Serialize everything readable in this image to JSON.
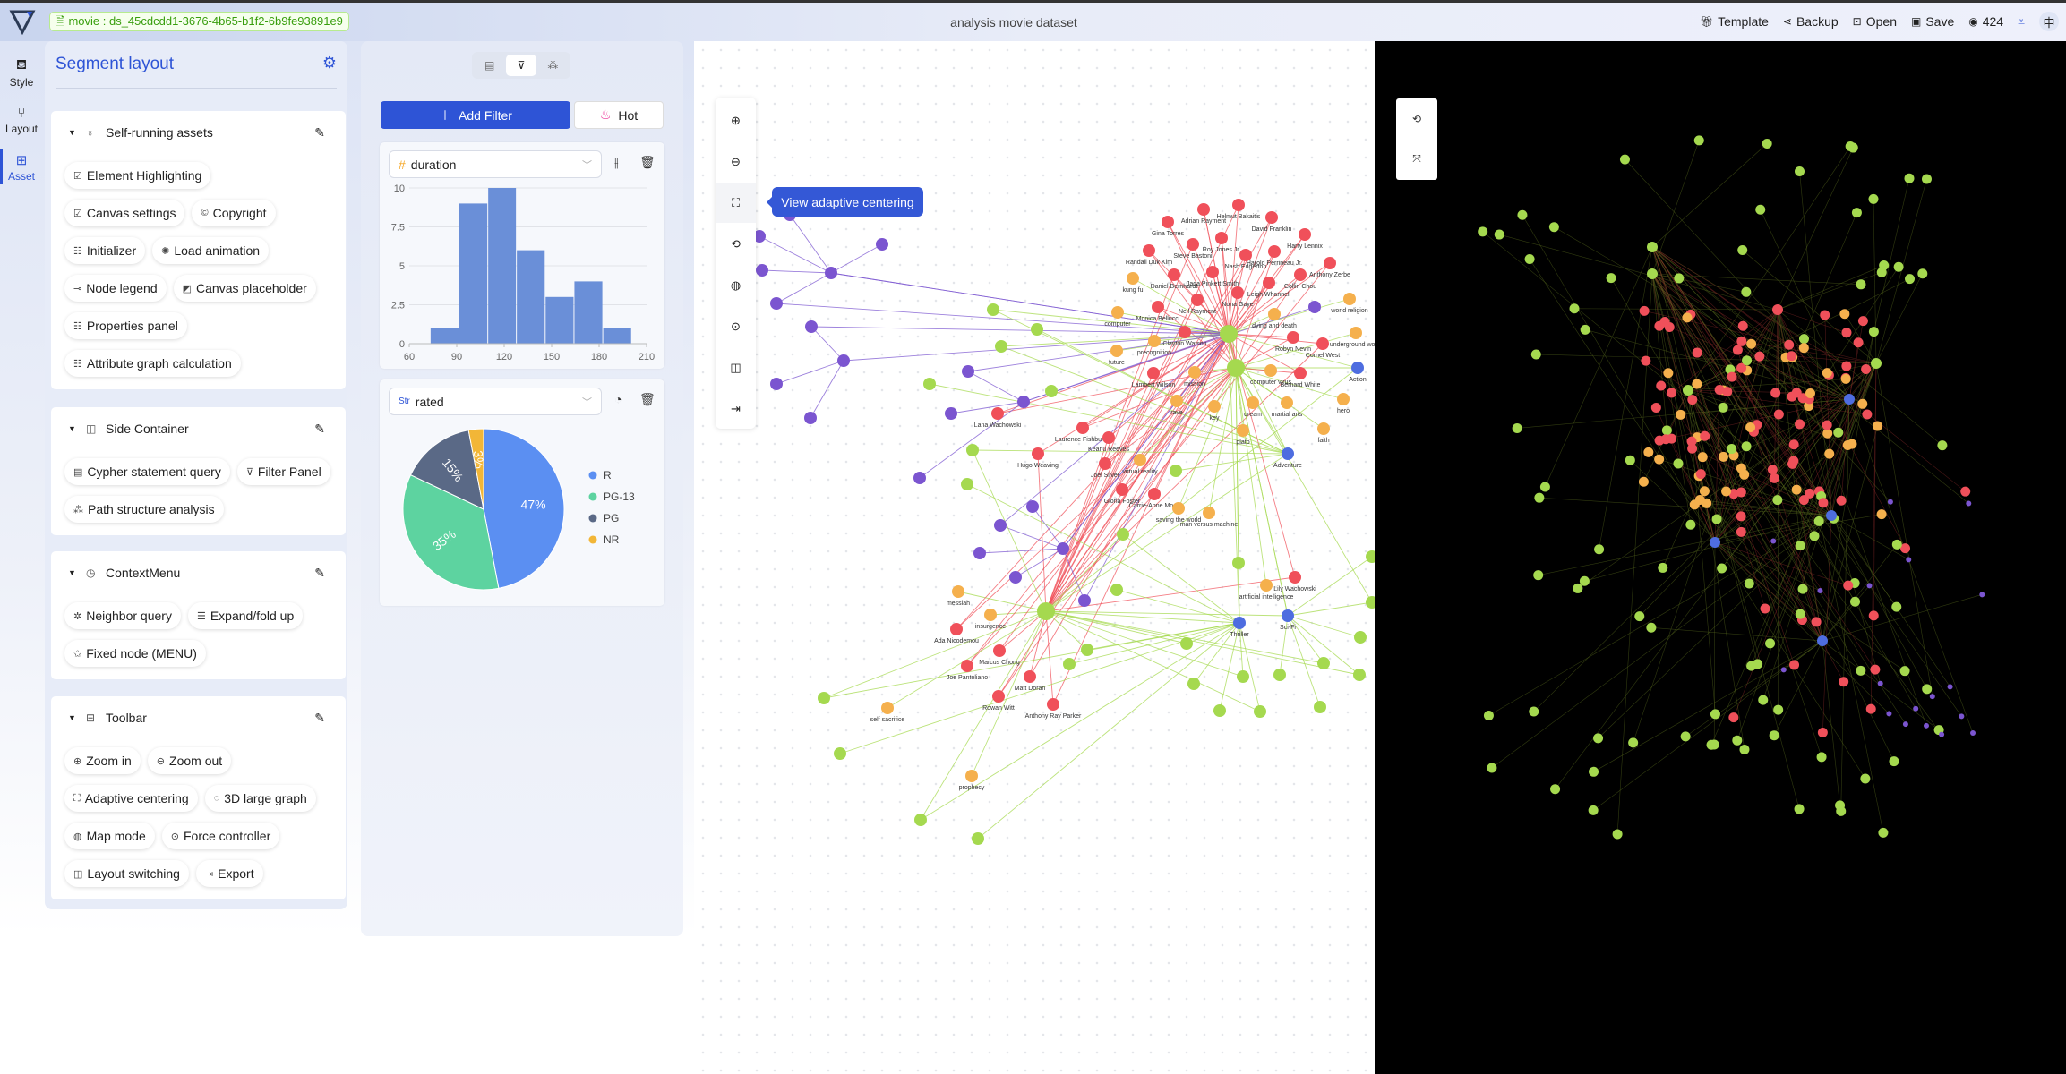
{
  "topbar": {
    "dataset": "movie : ds_45cdcdd1-3676-4b65-b1f2-6b9fe93891e9",
    "title": "analysis movie dataset",
    "actions": [
      {
        "icon": "gift-icon",
        "label": "Template"
      },
      {
        "icon": "share-icon",
        "label": "Backup"
      },
      {
        "icon": "terminal-icon",
        "label": "Open"
      },
      {
        "icon": "save-icon",
        "label": "Save"
      },
      {
        "icon": "github-icon",
        "label": "424"
      }
    ],
    "lang": "中"
  },
  "rail": [
    {
      "label": "Style",
      "icon": "paint-bucket-icon"
    },
    {
      "label": "Layout",
      "icon": "branch-icon"
    },
    {
      "label": "Asset",
      "icon": "grid-icon",
      "active": true
    }
  ],
  "segment": {
    "title": "Segment layout",
    "cards": [
      {
        "title": "Self-running assets",
        "items": [
          "Element Highlighting",
          "Canvas settings",
          "Copyright",
          "Initializer",
          "Load animation",
          "Node legend",
          "Canvas placeholder",
          "Properties panel",
          "Attribute graph calculation"
        ]
      },
      {
        "title": "Side Container",
        "items": [
          "Cypher statement query",
          "Filter Panel",
          "Path structure analysis"
        ]
      },
      {
        "title": "ContextMenu",
        "items": [
          "Neighbor query",
          "Expand/fold up",
          "Fixed node (MENU)"
        ]
      },
      {
        "title": "Toolbar",
        "items": [
          "Zoom in",
          "Zoom out",
          "Adaptive centering",
          "3D large graph",
          "Map mode",
          "Force controller",
          "Layout switching",
          "Export"
        ]
      }
    ]
  },
  "filter": {
    "add_label": "Add Filter",
    "hot_label": "Hot",
    "field1": "duration",
    "field1_type": "#",
    "field2": "rated",
    "field2_type": "Str"
  },
  "chart_data": [
    {
      "type": "bar",
      "subtype": "histogram",
      "field": "duration",
      "bins": [
        [
          73.5,
          91.7
        ],
        [
          91.7,
          109.9
        ],
        [
          109.9,
          128
        ],
        [
          128,
          146.2
        ],
        [
          146.2,
          164.4
        ],
        [
          164.4,
          182.6
        ],
        [
          182.6,
          200.8
        ]
      ],
      "values": [
        1,
        9,
        10,
        6,
        3,
        4,
        1
      ],
      "xticks": [
        "60",
        "90",
        "120",
        "150",
        "180",
        "210"
      ],
      "yticks": [
        "0",
        "2.5",
        "5",
        "7.5",
        "10"
      ],
      "xlim": [
        60,
        210
      ],
      "ylim": [
        0,
        10
      ],
      "grid": true,
      "color": "#6a8fd8"
    },
    {
      "type": "pie",
      "field": "rated",
      "categories": [
        "R",
        "PG-13",
        "PG",
        "NR"
      ],
      "values": [
        47,
        35,
        15,
        3
      ],
      "labels": [
        "47%",
        "35%",
        "15%",
        "3%"
      ],
      "colors": [
        "#5b8ff2",
        "#5dd3a0",
        "#5a6986",
        "#f2b637"
      ],
      "legend": "right"
    }
  ],
  "canvas": {
    "tooltip": "View adaptive centering",
    "tools": [
      "zoom-in-icon",
      "zoom-out-icon",
      "center-icon",
      "2d-icon",
      "globe-icon",
      "play-icon",
      "layout-icon",
      "export-icon"
    ]
  },
  "graph": {
    "colors": {
      "person": "#f0505a",
      "keyword": "#f5b04d",
      "movie": "#a5d94f",
      "user": "#7b55d0",
      "genre": "#4e6de0"
    },
    "labels": [
      "Helmut Bakaitis",
      "Adrian Rayment",
      "David Franklin",
      "Gina Torres",
      "Harry Lennix",
      "Roy Jones Jr.",
      "Steve Bastoni",
      "Randall Duk Kim",
      "Nash Edgerton",
      "Harold Perrineau Jr.",
      "Anthony Zerbe",
      "Jada Pinkett Smith",
      "Daniel Bernhardt",
      "Collin Chou",
      "Leigh Whannell",
      "Nona Gaye",
      "Neil Rayment",
      "Monica Bellucci",
      "kung fu",
      "world religion",
      "dying and death",
      "computer",
      "Clayton Watson",
      "Robyn Nevin",
      "Cornel West",
      "underground world",
      "precognition",
      "future",
      "Lambert Wilson",
      "mission",
      "computer virus",
      "Bernard White",
      "Action",
      "Lana Wachowski",
      "rave",
      "key",
      "dream",
      "martial arts",
      "hero",
      "faith",
      "plato",
      "Laurence Fishburne",
      "Keanu Reeves",
      "Adventure",
      "Hugo Weaving",
      "Joel Silver",
      "virtual reality",
      "Gloria Foster",
      "Carrie-Anne Moss",
      "saving the world",
      "man versus machine",
      "messiah",
      "Lily Wachowski",
      "artificial intelligence",
      "Thriller",
      "Sci-Fi",
      "insurgence",
      "Ada Nicodemou",
      "Marcus Chong",
      "Joe Pantoliano",
      "Matt Doran",
      "Rowan Witt",
      "Anthony Ray Parker",
      "prophecy",
      "self sacrifice"
    ]
  }
}
